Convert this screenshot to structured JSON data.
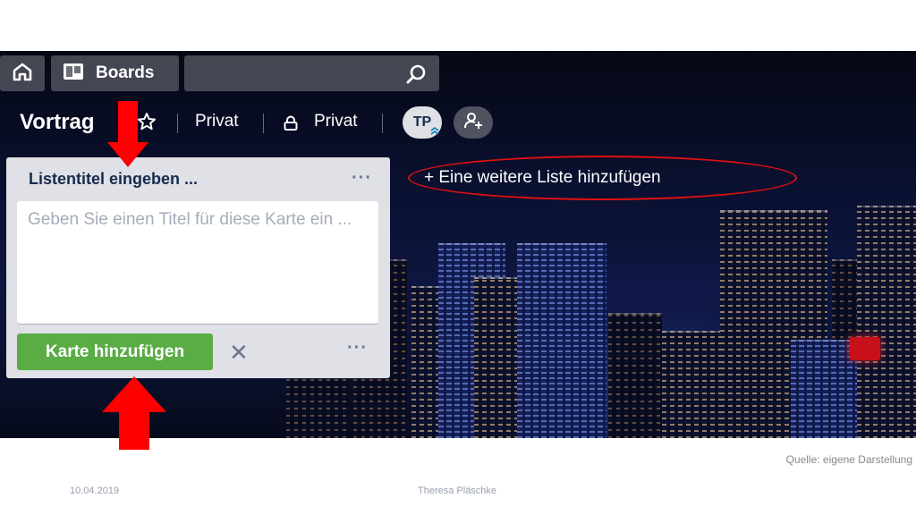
{
  "topbar": {
    "home_icon": "home-icon",
    "boards_label": "Boards",
    "boards_icon": "boards-icon",
    "search_icon": "search-icon",
    "search_value": ""
  },
  "board": {
    "title": "Vortrag",
    "visibility_team": "Privat",
    "visibility": "Privat",
    "member_initials": "TP"
  },
  "list_composer": {
    "title_placeholder": "Listentitel eingeben ...",
    "card_placeholder": "Geben Sie einen Titel für diese Karte ein ...",
    "add_card_label": "Karte hinzufügen",
    "close_glyph": "✕",
    "menu_glyph": "···"
  },
  "add_list_label": "+ Eine weitere Liste hinzufügen",
  "annotation_color": "#e01010",
  "footer": {
    "source": "Quelle: eigene Darstellung",
    "date": "10.04.2019",
    "author": "Theresa Pläschke"
  }
}
